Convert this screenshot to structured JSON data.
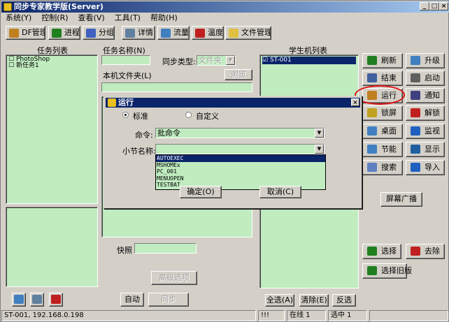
{
  "window": {
    "title": "同步专家教学版(Server)"
  },
  "menu": [
    "系统(Y)",
    "控制(R)",
    "查看(V)",
    "工具(T)",
    "帮助(H)"
  ],
  "toolbar": [
    {
      "label": "DF管理",
      "icon": "df-manage-icon",
      "color": "#c08020"
    },
    {
      "label": "进程",
      "icon": "process-icon",
      "color": "#208020"
    },
    {
      "label": "分组",
      "icon": "group-icon",
      "color": "#4060c0"
    },
    {
      "label": "详情",
      "icon": "detail-icon",
      "color": "#6080a0"
    },
    {
      "label": "流量",
      "icon": "traffic-icon",
      "color": "#4080c0"
    },
    {
      "label": "温度",
      "icon": "temperature-icon",
      "color": "#c02020"
    },
    {
      "label": "文件管理",
      "icon": "file-manage-icon",
      "color": "#e0c040"
    }
  ],
  "task_list": {
    "title": "任务列表",
    "items": [
      "PhotoShop",
      "新任务1"
    ]
  },
  "task_form": {
    "name_label": "任务名称(N)",
    "sync_type_label": "同步类型:",
    "sync_type_value": "文件夹",
    "local_folder_label": "本机文件夹(L)",
    "browse_label": "浏览",
    "snapshot_label": "快照",
    "advanced_label": "高级选项",
    "auto_label": "自动",
    "sync_label": "同步"
  },
  "students": {
    "title": "学生机列表",
    "items": [
      {
        "name": "ST-001",
        "checked": true
      }
    ],
    "select_all": "全选(A)",
    "clear": "清除(E)",
    "invert": "反选"
  },
  "right_buttons": [
    {
      "label": "刷新",
      "icon": "refresh-icon",
      "color": "#208020"
    },
    {
      "label": "升级",
      "icon": "upgrade-icon",
      "color": "#4080c0"
    },
    {
      "label": "结束",
      "icon": "end-icon",
      "color": "#4060a0"
    },
    {
      "label": "启动",
      "icon": "start-icon",
      "color": "#606060"
    },
    {
      "label": "运行",
      "icon": "run-icon",
      "color": "#c08020"
    },
    {
      "label": "通知",
      "icon": "notify-icon",
      "color": "#404080"
    },
    {
      "label": "锁屏",
      "icon": "lock-screen-icon",
      "color": "#c0a020"
    },
    {
      "label": "解锁",
      "icon": "unlock-icon",
      "color": "#c02020"
    },
    {
      "label": "桌面",
      "icon": "desktop-icon",
      "color": "#4080c0"
    },
    {
      "label": "监视",
      "icon": "monitor-icon",
      "color": "#2060c0"
    },
    {
      "label": "节能",
      "icon": "power-save-icon",
      "color": "#4080c0"
    },
    {
      "label": "显示",
      "icon": "display-icon",
      "color": "#2060a0"
    },
    {
      "label": "搜索",
      "icon": "search-icon",
      "color": "#6080c0"
    },
    {
      "label": "导入",
      "icon": "import-icon",
      "color": "#2060c0"
    }
  ],
  "screen_broadcast": "屏幕广播",
  "select_label": "选择",
  "remove_label": "去除",
  "select_old_label": "选择旧版",
  "dialog": {
    "title": "运行",
    "radio_standard": "标准",
    "radio_custom": "自定义",
    "command_label": "命令:",
    "command_value": "批命令",
    "section_label": "小节名称:",
    "section_value": "",
    "options": [
      "AUTOEXEC",
      "MSHOMEx",
      "PC_001",
      "MENUOPEN",
      "TESTBAT"
    ],
    "ok_label": "确定(O)",
    "cancel_label": "取消(C)"
  },
  "statusbar": {
    "address": "ST-001, 192.168.0.198",
    "ind": "!!!",
    "online": "在线 1",
    "selected": "选中 1"
  }
}
